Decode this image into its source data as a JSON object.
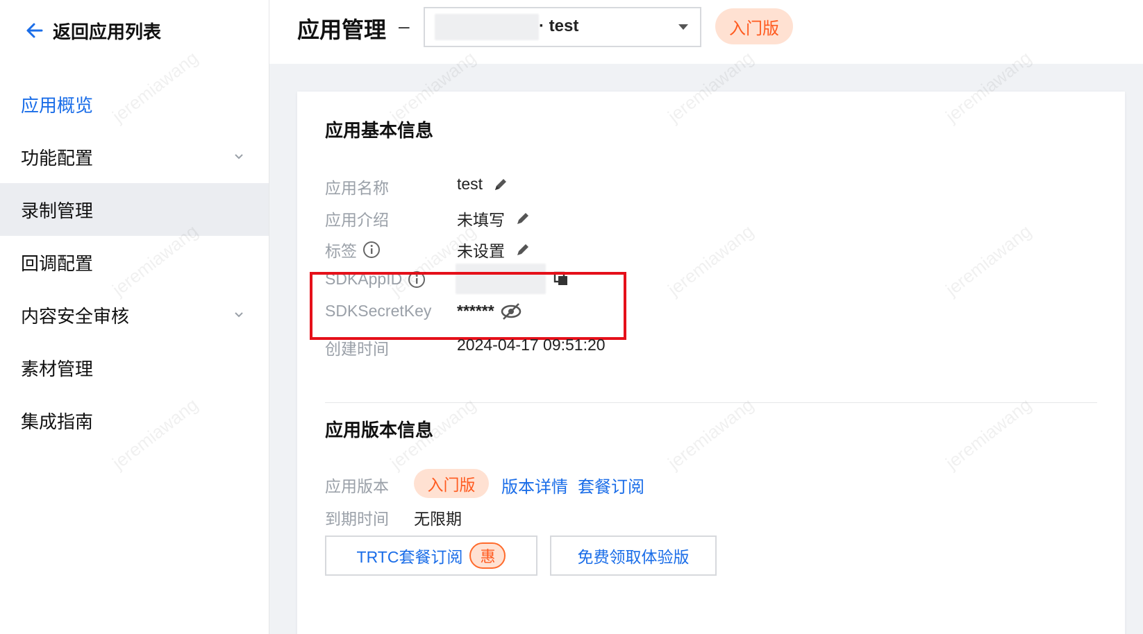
{
  "sidebar": {
    "back_label": "返回应用列表",
    "items": [
      {
        "label": "应用概览",
        "state": "active",
        "expandable": false
      },
      {
        "label": "功能配置",
        "state": "normal",
        "expandable": true
      },
      {
        "label": "录制管理",
        "state": "selected",
        "expandable": false
      },
      {
        "label": "回调配置",
        "state": "normal",
        "expandable": false
      },
      {
        "label": "内容安全审核",
        "state": "normal",
        "expandable": true
      },
      {
        "label": "素材管理",
        "state": "normal",
        "expandable": false
      },
      {
        "label": "集成指南",
        "state": "normal",
        "expandable": false
      }
    ]
  },
  "header": {
    "title": "应用管理",
    "separator": "–",
    "app_select_value": "· test",
    "edition_badge": "入门版"
  },
  "basic_info": {
    "title": "应用基本信息",
    "app_name_label": "应用名称",
    "app_name_value": "test",
    "app_intro_label": "应用介绍",
    "app_intro_value": "未填写",
    "tags_label": "标签",
    "tags_value": "未设置",
    "sdkappid_label": "SDKAppID",
    "sdksecretkey_label": "SDKSecretKey",
    "sdksecretkey_value": "******",
    "created_label": "创建时间",
    "created_value": "2024-04-17 09:51:20"
  },
  "version_info": {
    "title": "应用版本信息",
    "version_label": "应用版本",
    "version_badge": "入门版",
    "version_detail_link": "版本详情",
    "subscribe_link": "套餐订阅",
    "expire_label": "到期时间",
    "expire_value": "无限期",
    "trtc_button": "TRTC套餐订阅",
    "trtc_badge": "惠",
    "trial_button": "免费领取体验版"
  },
  "colors": {
    "accent": "#1a6de8",
    "badge_bg": "#ffe1d2",
    "badge_text": "#ff5a1f",
    "highlight_border": "#e5101a"
  },
  "watermark": "jeremiawang"
}
